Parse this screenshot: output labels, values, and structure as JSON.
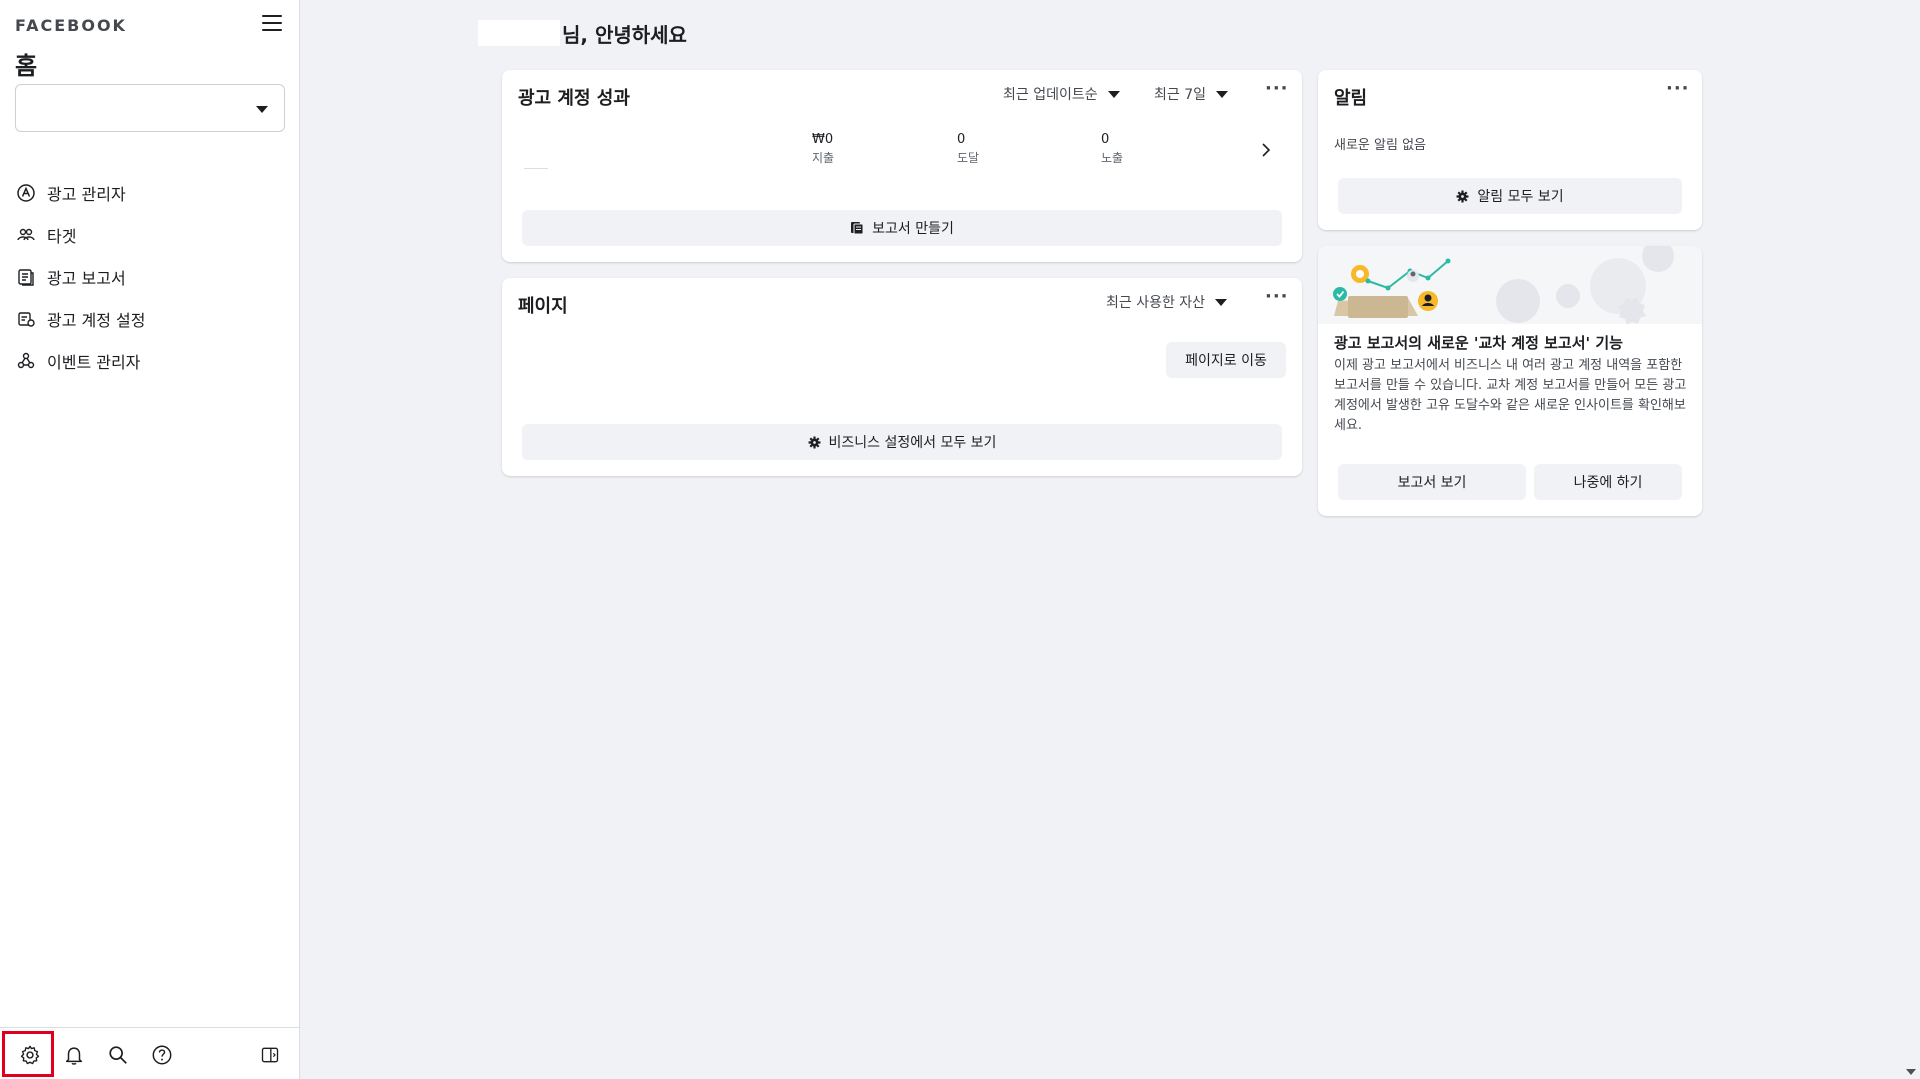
{
  "sidebar": {
    "brand": "FACEBOOK",
    "title": "홈",
    "account_select_value": "",
    "nav": [
      {
        "label": "광고 관리자",
        "icon": "ads-manager-icon"
      },
      {
        "label": "타겟",
        "icon": "audience-icon"
      },
      {
        "label": "광고 보고서",
        "icon": "reports-icon"
      },
      {
        "label": "광고 계정 설정",
        "icon": "account-settings-icon"
      },
      {
        "label": "이벤트 관리자",
        "icon": "events-manager-icon"
      }
    ],
    "bottom_icons": [
      "settings-icon",
      "bell-icon",
      "search-icon",
      "help-icon",
      "panel-toggle-icon"
    ]
  },
  "greeting": {
    "suffix": "님, 안녕하세요"
  },
  "performance": {
    "title": "광고 계정 성과",
    "sort_label": "최근 업데이트순",
    "range_label": "최근 7일",
    "metrics": [
      {
        "value": "₩0",
        "label": "지출"
      },
      {
        "value": "0",
        "label": "도달"
      },
      {
        "value": "0",
        "label": "노출"
      }
    ],
    "button_label": "보고서 만들기"
  },
  "pages": {
    "title": "페이지",
    "sort_label": "최근 사용한 자산",
    "goto_label": "페이지로 이동",
    "button_label": "비즈니스 설정에서 모두 보기"
  },
  "alerts": {
    "title": "알림",
    "empty_text": "새로운 알림 없음",
    "button_label": "알림 모두 보기"
  },
  "promo": {
    "title": "광고 보고서의 새로운 '교차 계정 보고서' 기능",
    "body": "이제 광고 보고서에서 비즈니스 내 여러 광고 계정 내역을 포함한 보고서를 만들 수 있습니다. 교차 계정 보고서를 만들어 모든 광고 계정에서 발생한 고유 도달수와 같은 새로운 인사이트를 확인해보세요.",
    "primary_label": "보고서 보기",
    "secondary_label": "나중에 하기"
  },
  "colors": {
    "highlight": "#e0001b",
    "background": "#f0f2f5",
    "card": "#ffffff",
    "accent_green": "#2abba7"
  }
}
